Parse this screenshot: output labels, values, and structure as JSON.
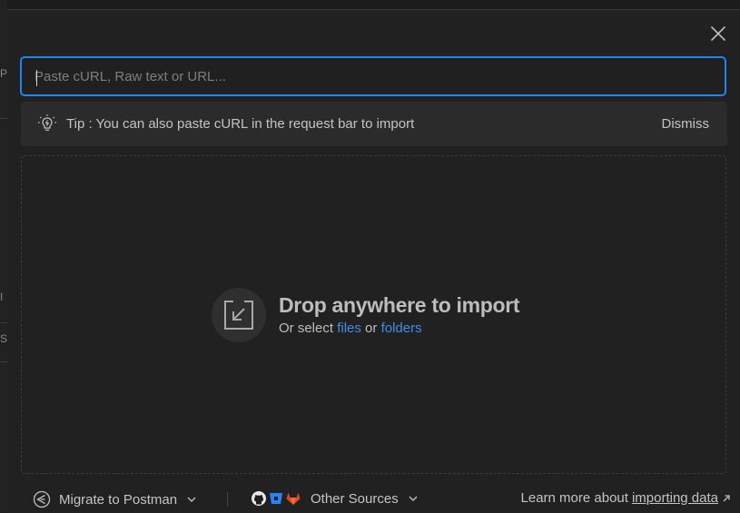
{
  "background": {
    "fragments": [
      "P",
      "I",
      "S"
    ]
  },
  "modal": {
    "url_input": {
      "placeholder": "Paste cURL, Raw text or URL...",
      "value": ""
    },
    "tip": {
      "text": "Tip : You can also paste cURL in the request bar to import",
      "dismiss_label": "Dismiss",
      "icon": "lightbulb-icon"
    },
    "drop_zone": {
      "title": "Drop anywhere to import",
      "subtitle_prefix": "Or select",
      "files_link": "files",
      "or_text": "or",
      "folders_link": "folders",
      "icon": "import-icon"
    },
    "footer": {
      "migrate_label": "Migrate to Postman",
      "other_sources_label": "Other Sources",
      "learn_prefix": "Learn more about",
      "learn_link": "importing data"
    }
  },
  "colors": {
    "accent": "#1e86f0",
    "link": "#3d8fe8",
    "modal_bg": "#212121",
    "tip_bg": "#2b2b2b",
    "gitlab": "#e24329",
    "bitbucket": "#2684ff"
  }
}
